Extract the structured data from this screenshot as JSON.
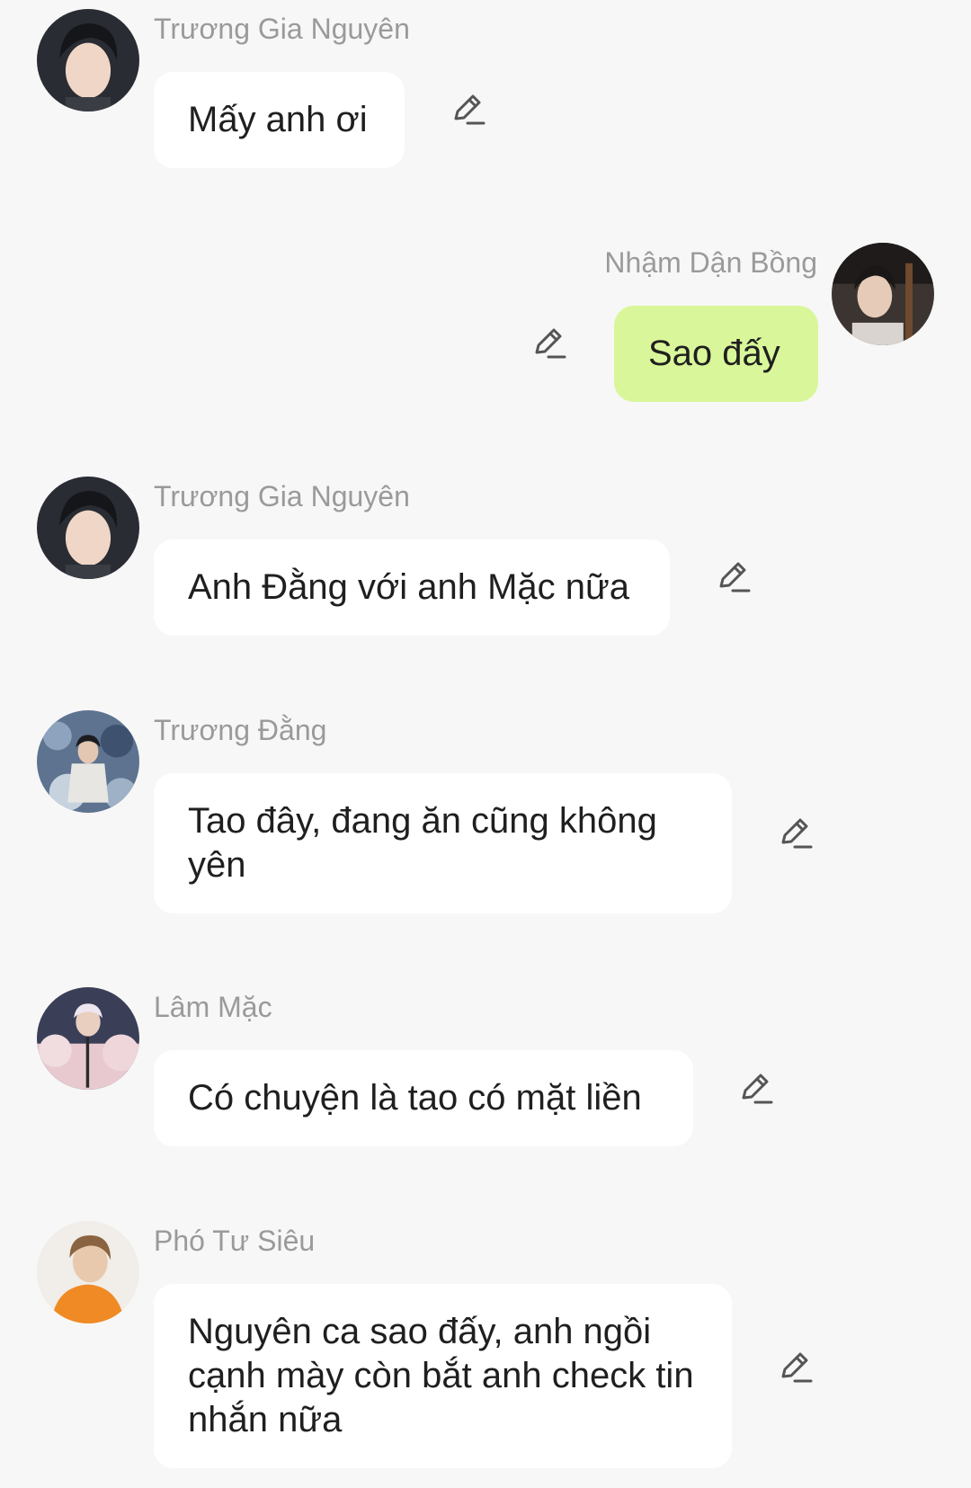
{
  "messages": [
    {
      "sender": "Trương Gia Nguyên",
      "text": "Mấy anh ơi",
      "side": "left",
      "avatar": "avatar-truong-gia-nguyen"
    },
    {
      "sender": "Nhậm Dận Bồng",
      "text": "Sao đấy",
      "side": "right",
      "avatar": "avatar-nham-dan-bong"
    },
    {
      "sender": "Trương Gia Nguyên",
      "text": "Anh Đằng với anh Mặc nữa",
      "side": "left",
      "avatar": "avatar-truong-gia-nguyen"
    },
    {
      "sender": "Trương Đằng",
      "text": "Tao đây, đang ăn cũng không yên",
      "side": "left",
      "avatar": "avatar-truong-dang"
    },
    {
      "sender": "Lâm Mặc",
      "text": "Có chuyện là tao có mặt liền",
      "side": "left",
      "avatar": "avatar-lam-mac"
    },
    {
      "sender": "Phó Tư Siêu",
      "text": "Nguyên ca sao đấy, anh ngồi cạnh mày còn bắt anh check tin nhắn nữa",
      "side": "left",
      "avatar": "avatar-pho-tu-sieu"
    }
  ],
  "colors": {
    "background": "#f7f7f7",
    "bubble": "#ffffff",
    "bubble_mine": "#d9f79a",
    "sender": "#9a9a9a",
    "text": "#1f1f1f",
    "icon": "#555555"
  },
  "icons": {
    "edit": "pencil-edit-icon"
  }
}
